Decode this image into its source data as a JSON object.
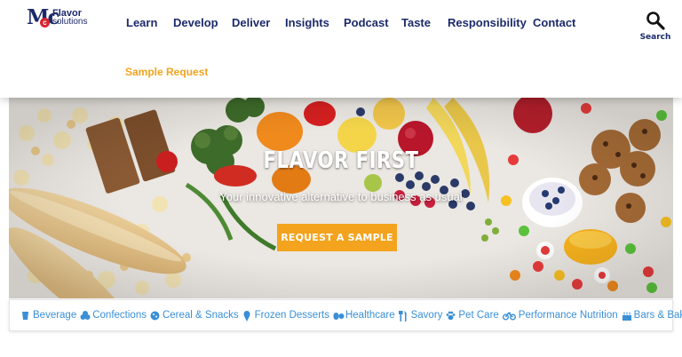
{
  "brand": {
    "line1": "Flavor",
    "line2": "solutions",
    "mark": "Mc"
  },
  "nav": {
    "items": [
      "Learn",
      "Develop",
      "Deliver",
      "Insights",
      "Podcast",
      "Taste",
      "Responsibility",
      "Contact"
    ],
    "secondary": "Sample Request",
    "search_label": "Search"
  },
  "hero": {
    "title": "FLAVOR FIRST",
    "subtitle": "Your innovative alternative to business as usual",
    "button": "REQUEST A SAMPLE"
  },
  "categories": [
    {
      "label": "Beverage",
      "icon": "cup-icon"
    },
    {
      "label": "Confections",
      "icon": "candy-icon"
    },
    {
      "label": "Cereal & Snacks",
      "icon": "cookie-icon"
    },
    {
      "label": "Frozen Desserts",
      "icon": "ice-cream-icon"
    },
    {
      "label": "Healthcare",
      "icon": "pills-icon"
    },
    {
      "label": "Savory",
      "icon": "utensils-icon"
    },
    {
      "label": "Pet Care",
      "icon": "paw-icon"
    },
    {
      "label": "Performance Nutrition",
      "icon": "bicycle-icon"
    },
    {
      "label": "Bars & Bakery",
      "icon": "cake-icon"
    }
  ],
  "colors": {
    "navy": "#1c2a6b",
    "accent_orange": "#f4a31e",
    "link_blue": "#3a8fd6",
    "heading_purple": "#7b1fa2",
    "logo_red": "#d8262f"
  }
}
